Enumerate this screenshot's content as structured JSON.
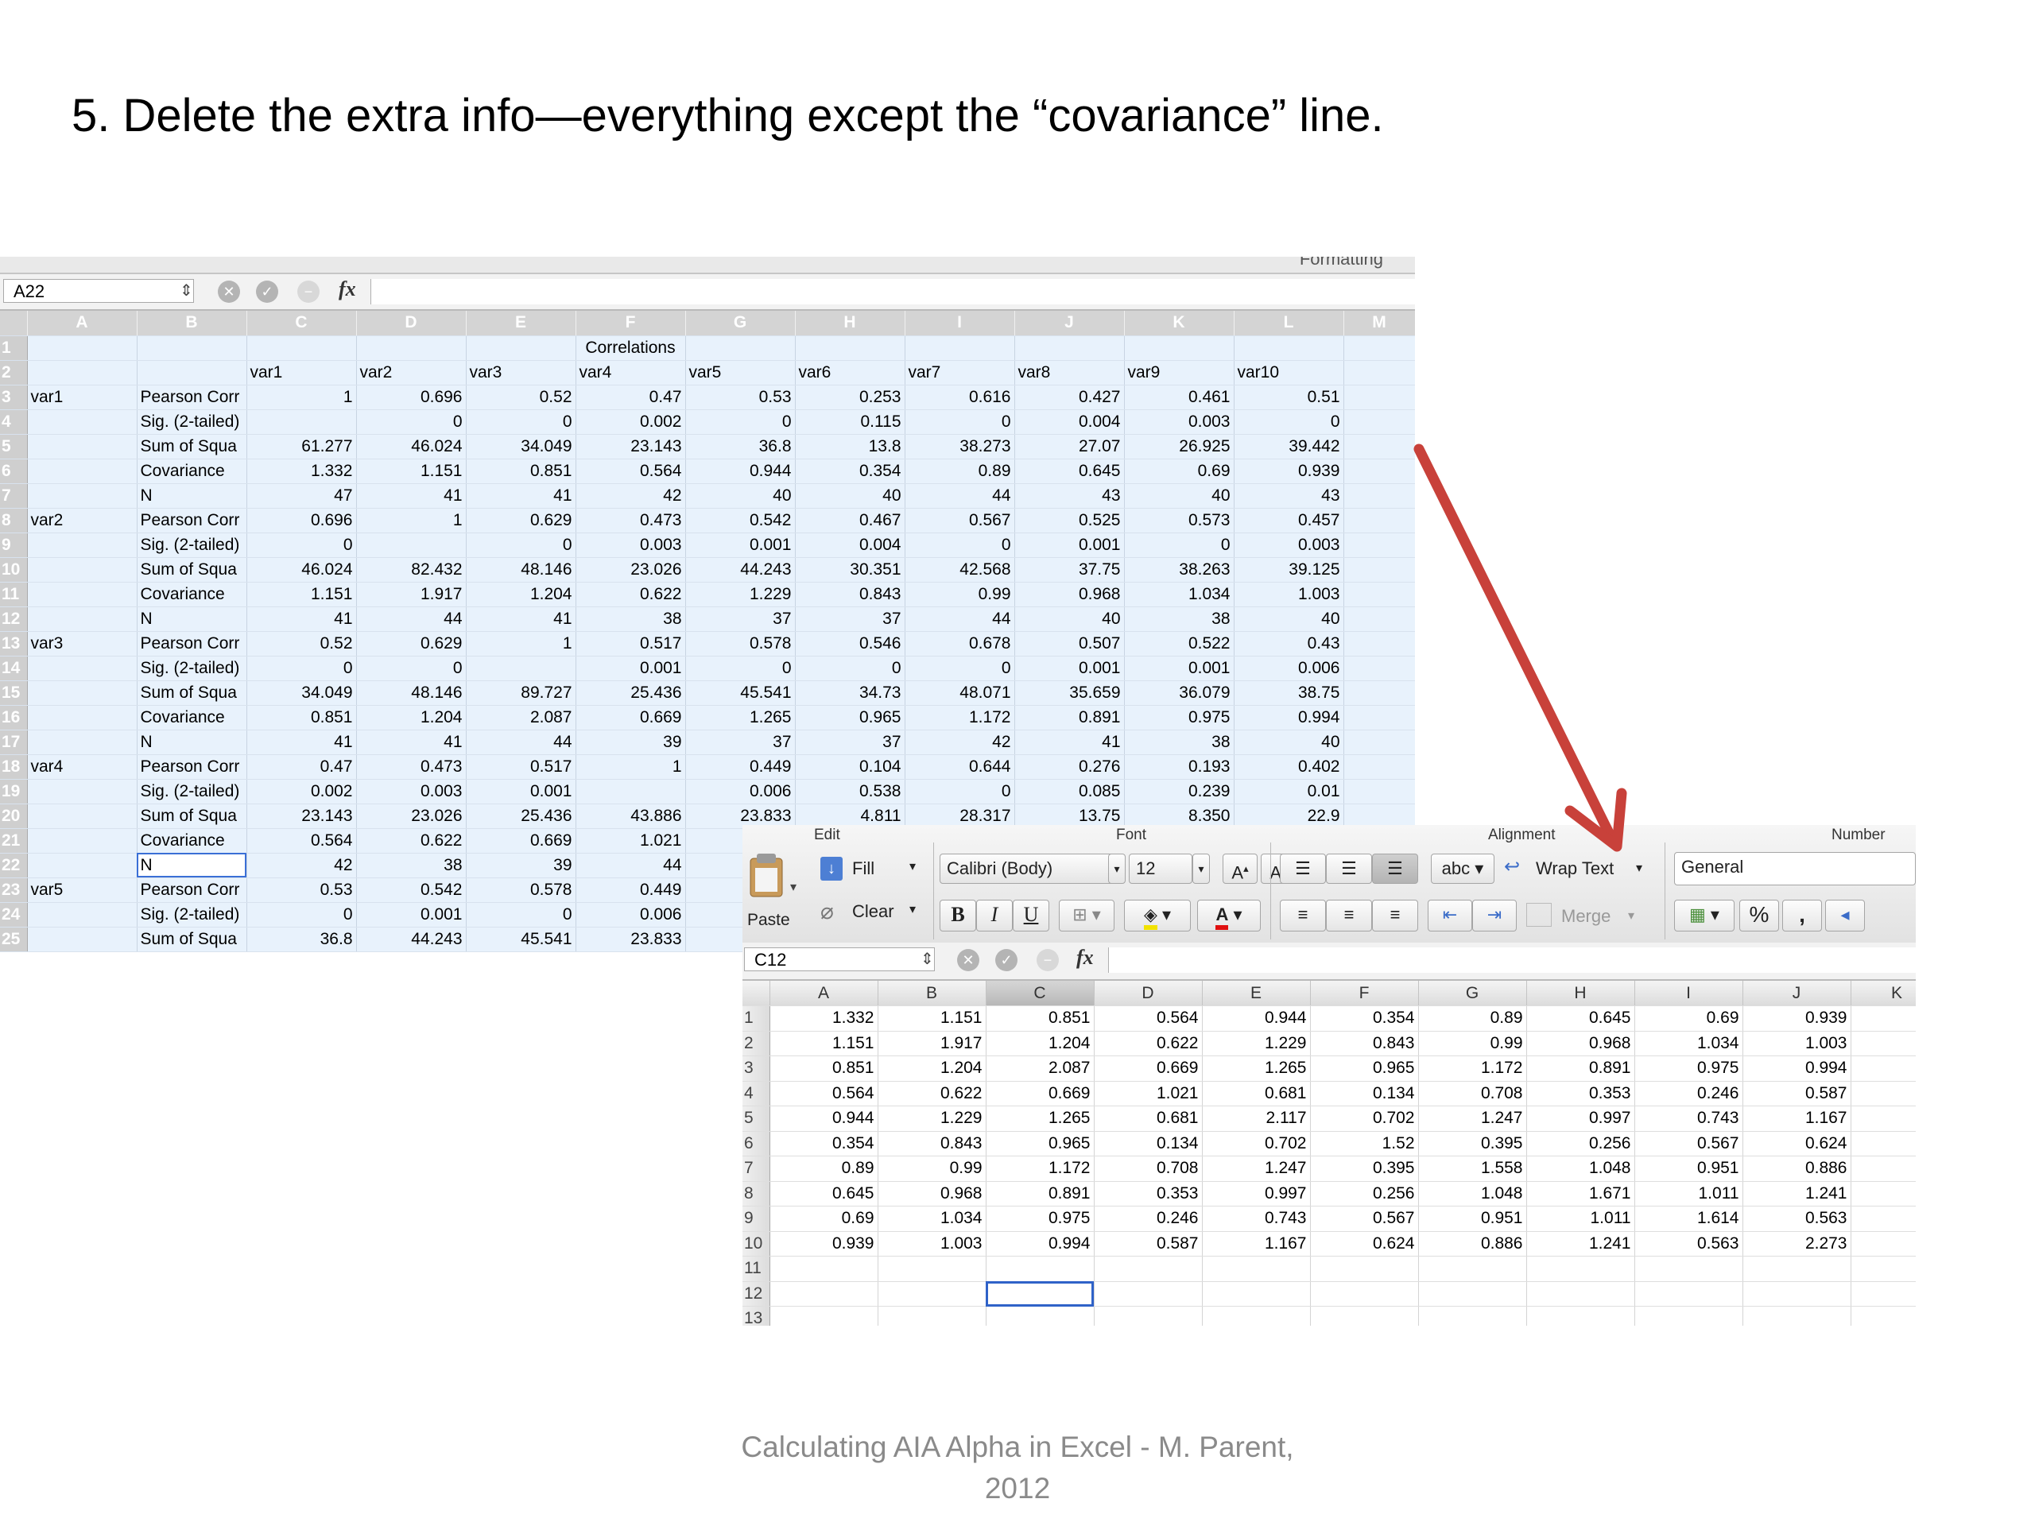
{
  "slide": {
    "title": "5. Delete the extra info—everything except the “covariance” line.",
    "footer_line1": "Calculating AIA Alpha in Excel - M. Parent,",
    "footer_line2": "2012"
  },
  "sheet1": {
    "ribbon_fragment": "Formatting",
    "name_box": "A22",
    "fx_label": "fx",
    "columns": [
      "",
      "A",
      "B",
      "C",
      "D",
      "E",
      "F",
      "G",
      "H",
      "I",
      "J",
      "K",
      "L",
      "M"
    ],
    "rows": [
      [
        "1",
        "",
        "",
        "",
        "",
        "",
        "Correlations",
        "",
        "",
        "",
        "",
        "",
        "",
        ""
      ],
      [
        "2",
        "",
        "",
        "var1",
        "var2",
        "var3",
        "var4",
        "var5",
        "var6",
        "var7",
        "var8",
        "var9",
        "var10",
        ""
      ],
      [
        "3",
        "var1",
        "Pearson Corr",
        "1",
        "0.696",
        "0.52",
        "0.47",
        "0.53",
        "0.253",
        "0.616",
        "0.427",
        "0.461",
        "0.51",
        ""
      ],
      [
        "4",
        "",
        "Sig. (2-tailed)",
        "",
        "0",
        "0",
        "0.002",
        "0",
        "0.115",
        "0",
        "0.004",
        "0.003",
        "0",
        ""
      ],
      [
        "5",
        "",
        "Sum of Squa",
        "61.277",
        "46.024",
        "34.049",
        "23.143",
        "36.8",
        "13.8",
        "38.273",
        "27.07",
        "26.925",
        "39.442",
        ""
      ],
      [
        "6",
        "",
        "Covariance",
        "1.332",
        "1.151",
        "0.851",
        "0.564",
        "0.944",
        "0.354",
        "0.89",
        "0.645",
        "0.69",
        "0.939",
        ""
      ],
      [
        "7",
        "",
        "N",
        "47",
        "41",
        "41",
        "42",
        "40",
        "40",
        "44",
        "43",
        "40",
        "43",
        ""
      ],
      [
        "8",
        "var2",
        "Pearson Corr",
        "0.696",
        "1",
        "0.629",
        "0.473",
        "0.542",
        "0.467",
        "0.567",
        "0.525",
        "0.573",
        "0.457",
        ""
      ],
      [
        "9",
        "",
        "Sig. (2-tailed)",
        "0",
        "",
        "0",
        "0.003",
        "0.001",
        "0.004",
        "0",
        "0.001",
        "0",
        "0.003",
        ""
      ],
      [
        "10",
        "",
        "Sum of Squa",
        "46.024",
        "82.432",
        "48.146",
        "23.026",
        "44.243",
        "30.351",
        "42.568",
        "37.75",
        "38.263",
        "39.125",
        ""
      ],
      [
        "11",
        "",
        "Covariance",
        "1.151",
        "1.917",
        "1.204",
        "0.622",
        "1.229",
        "0.843",
        "0.99",
        "0.968",
        "1.034",
        "1.003",
        ""
      ],
      [
        "12",
        "",
        "N",
        "41",
        "44",
        "41",
        "38",
        "37",
        "37",
        "44",
        "40",
        "38",
        "40",
        ""
      ],
      [
        "13",
        "var3",
        "Pearson Corr",
        "0.52",
        "0.629",
        "1",
        "0.517",
        "0.578",
        "0.546",
        "0.678",
        "0.507",
        "0.522",
        "0.43",
        ""
      ],
      [
        "14",
        "",
        "Sig. (2-tailed)",
        "0",
        "0",
        "",
        "0.001",
        "0",
        "0",
        "0",
        "0.001",
        "0.001",
        "0.006",
        ""
      ],
      [
        "15",
        "",
        "Sum of Squa",
        "34.049",
        "48.146",
        "89.727",
        "25.436",
        "45.541",
        "34.73",
        "48.071",
        "35.659",
        "36.079",
        "38.75",
        ""
      ],
      [
        "16",
        "",
        "Covariance",
        "0.851",
        "1.204",
        "2.087",
        "0.669",
        "1.265",
        "0.965",
        "1.172",
        "0.891",
        "0.975",
        "0.994",
        ""
      ],
      [
        "17",
        "",
        "N",
        "41",
        "41",
        "44",
        "39",
        "37",
        "37",
        "42",
        "41",
        "38",
        "40",
        ""
      ],
      [
        "18",
        "var4",
        "Pearson Corr",
        "0.47",
        "0.473",
        "0.517",
        "1",
        "0.449",
        "0.104",
        "0.644",
        "0.276",
        "0.193",
        "0.402",
        ""
      ],
      [
        "19",
        "",
        "Sig. (2-tailed)",
        "0.002",
        "0.003",
        "0.001",
        "",
        "0.006",
        "0.538",
        "0",
        "0.085",
        "0.239",
        "0.01",
        ""
      ],
      [
        "20",
        "",
        "Sum of Squa",
        "23.143",
        "23.026",
        "25.436",
        "43.886",
        "23.833",
        "4.811",
        "28.317",
        "13.75",
        "8.350",
        "22.9",
        ""
      ],
      [
        "21",
        "",
        "Covariance",
        "0.564",
        "0.622",
        "0.669",
        "1.021",
        "",
        "",
        "",
        "",
        "",
        "",
        ""
      ],
      [
        "22",
        "",
        "N",
        "42",
        "38",
        "39",
        "44",
        "",
        "",
        "",
        "",
        "",
        "",
        ""
      ],
      [
        "23",
        "var5",
        "Pearson Corr",
        "0.53",
        "0.542",
        "0.578",
        "0.449",
        "",
        "",
        "",
        "",
        "",
        "",
        ""
      ],
      [
        "24",
        "",
        "Sig. (2-tailed)",
        "0",
        "0.001",
        "0",
        "0.006",
        "",
        "",
        "",
        "",
        "",
        "",
        ""
      ],
      [
        "25",
        "",
        "Sum of Squa",
        "36.8",
        "44.243",
        "45.541",
        "23.833",
        "8",
        "",
        "",
        "",
        "",
        "",
        ""
      ]
    ]
  },
  "sheet2": {
    "ribbon": {
      "group_edit": "Edit",
      "group_font": "Font",
      "group_alignment": "Alignment",
      "group_number": "Number",
      "paste_label": "Paste",
      "fill_label": "Fill",
      "clear_label": "Clear",
      "font_name": "Calibri (Body)",
      "font_size": "12",
      "grow_font": "A",
      "shrink_font": "A",
      "bold": "B",
      "italic": "I",
      "underline": "U",
      "wrap_abc": "abc",
      "wrap_text": "Wrap Text",
      "merge_label": "Merge",
      "number_format": "General",
      "percent": "%",
      "comma": ","
    },
    "name_box": "C12",
    "fx_label": "fx",
    "columns": [
      "",
      "A",
      "B",
      "C",
      "D",
      "E",
      "F",
      "G",
      "H",
      "I",
      "J",
      "K"
    ],
    "rows": [
      [
        "1",
        "1.332",
        "1.151",
        "0.851",
        "0.564",
        "0.944",
        "0.354",
        "0.89",
        "0.645",
        "0.69",
        "0.939",
        ""
      ],
      [
        "2",
        "1.151",
        "1.917",
        "1.204",
        "0.622",
        "1.229",
        "0.843",
        "0.99",
        "0.968",
        "1.034",
        "1.003",
        ""
      ],
      [
        "3",
        "0.851",
        "1.204",
        "2.087",
        "0.669",
        "1.265",
        "0.965",
        "1.172",
        "0.891",
        "0.975",
        "0.994",
        ""
      ],
      [
        "4",
        "0.564",
        "0.622",
        "0.669",
        "1.021",
        "0.681",
        "0.134",
        "0.708",
        "0.353",
        "0.246",
        "0.587",
        ""
      ],
      [
        "5",
        "0.944",
        "1.229",
        "1.265",
        "0.681",
        "2.117",
        "0.702",
        "1.247",
        "0.997",
        "0.743",
        "1.167",
        ""
      ],
      [
        "6",
        "0.354",
        "0.843",
        "0.965",
        "0.134",
        "0.702",
        "1.52",
        "0.395",
        "0.256",
        "0.567",
        "0.624",
        ""
      ],
      [
        "7",
        "0.89",
        "0.99",
        "1.172",
        "0.708",
        "1.247",
        "0.395",
        "1.558",
        "1.048",
        "0.951",
        "0.886",
        ""
      ],
      [
        "8",
        "0.645",
        "0.968",
        "0.891",
        "0.353",
        "0.997",
        "0.256",
        "1.048",
        "1.671",
        "1.011",
        "1.241",
        ""
      ],
      [
        "9",
        "0.69",
        "1.034",
        "0.975",
        "0.246",
        "0.743",
        "0.567",
        "0.951",
        "1.011",
        "1.614",
        "0.563",
        ""
      ],
      [
        "10",
        "0.939",
        "1.003",
        "0.994",
        "0.587",
        "1.167",
        "0.624",
        "0.886",
        "1.241",
        "0.563",
        "2.273",
        ""
      ],
      [
        "11",
        "",
        "",
        "",
        "",
        "",
        "",
        "",
        "",
        "",
        "",
        ""
      ],
      [
        "12",
        "",
        "",
        "",
        "",
        "",
        "",
        "",
        "",
        "",
        "",
        ""
      ],
      [
        "13",
        "",
        "",
        "",
        "",
        "",
        "",
        "",
        "",
        "",
        "",
        ""
      ]
    ]
  },
  "annotation": {
    "arrow_color": "#c8413a"
  }
}
